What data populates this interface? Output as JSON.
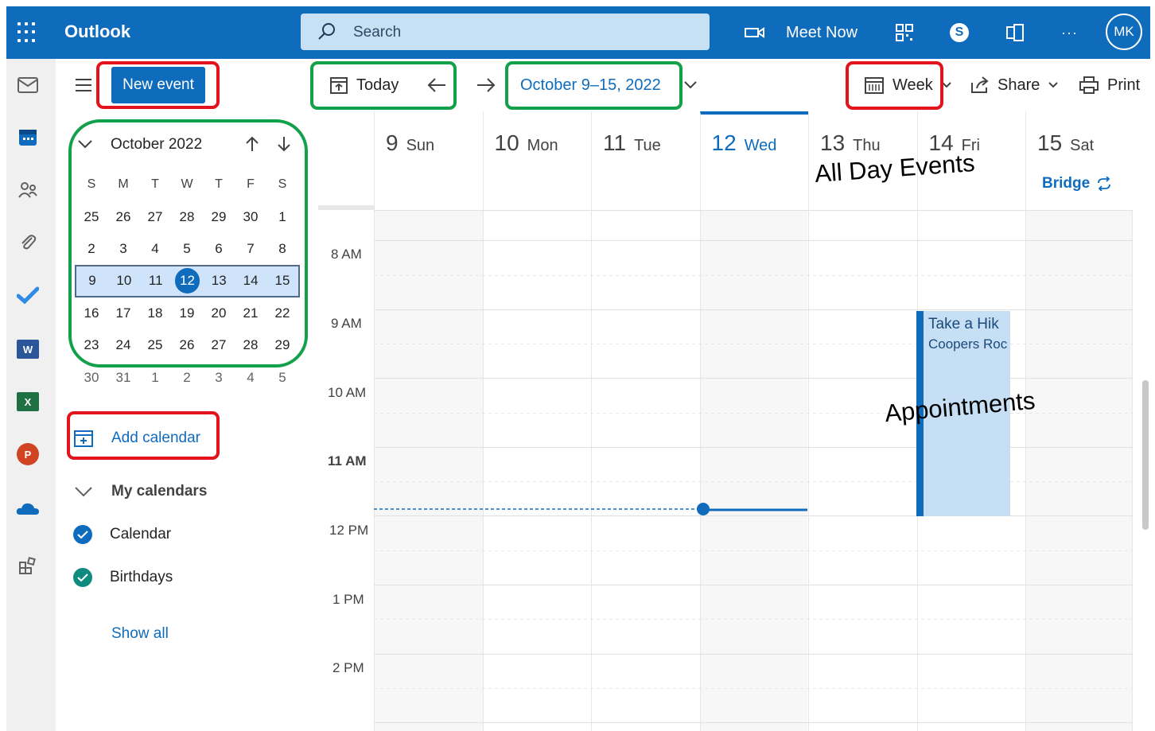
{
  "app": {
    "name": "Outlook",
    "user_initials": "MK"
  },
  "search": {
    "placeholder": "Search"
  },
  "topbar": {
    "meet_now": "Meet Now",
    "more": "···"
  },
  "toolbar": {
    "new_event": "New event",
    "today": "Today",
    "date_range": "October 9–15, 2022",
    "view": "Week",
    "share": "Share",
    "print": "Print"
  },
  "mini_calendar": {
    "title": "October 2022",
    "weekday_headers": [
      "S",
      "M",
      "T",
      "W",
      "T",
      "F",
      "S"
    ],
    "weeks": [
      [
        "25",
        "26",
        "27",
        "28",
        "29",
        "30",
        "1"
      ],
      [
        "2",
        "3",
        "4",
        "5",
        "6",
        "7",
        "8"
      ],
      [
        "9",
        "10",
        "11",
        "12",
        "13",
        "14",
        "15"
      ],
      [
        "16",
        "17",
        "18",
        "19",
        "20",
        "21",
        "22"
      ],
      [
        "23",
        "24",
        "25",
        "26",
        "27",
        "28",
        "29"
      ],
      [
        "30",
        "31",
        "1",
        "2",
        "3",
        "4",
        "5"
      ]
    ],
    "today": "12"
  },
  "sidebar": {
    "add_calendar": "Add calendar",
    "my_calendars": "My calendars",
    "calendars": [
      {
        "name": "Calendar",
        "color": "#0f6cbd"
      },
      {
        "name": "Birthdays",
        "color": "#0f8a7e"
      }
    ],
    "show_all": "Show all"
  },
  "week": {
    "days": [
      {
        "num": "9",
        "name": "Sun"
      },
      {
        "num": "10",
        "name": "Mon"
      },
      {
        "num": "11",
        "name": "Tue"
      },
      {
        "num": "12",
        "name": "Wed"
      },
      {
        "num": "13",
        "name": "Thu"
      },
      {
        "num": "14",
        "name": "Fri"
      },
      {
        "num": "15",
        "name": "Sat"
      }
    ],
    "selected_day": "12",
    "all_day_event": {
      "title": "Bridge",
      "day": "15"
    },
    "times": [
      "8 AM",
      "9 AM",
      "10 AM",
      "11 AM",
      "12 PM",
      "1 PM",
      "2 PM"
    ],
    "events": [
      {
        "title": "Take a Hik",
        "location": "Coopers Roc",
        "day": "14"
      }
    ]
  },
  "annotations": {
    "all_day_events": "All Day Events",
    "appointments": "Appointments"
  },
  "colors": {
    "brand": "#0f6cbd",
    "red_box": "#e3121b",
    "green_box": "#13a04b"
  }
}
